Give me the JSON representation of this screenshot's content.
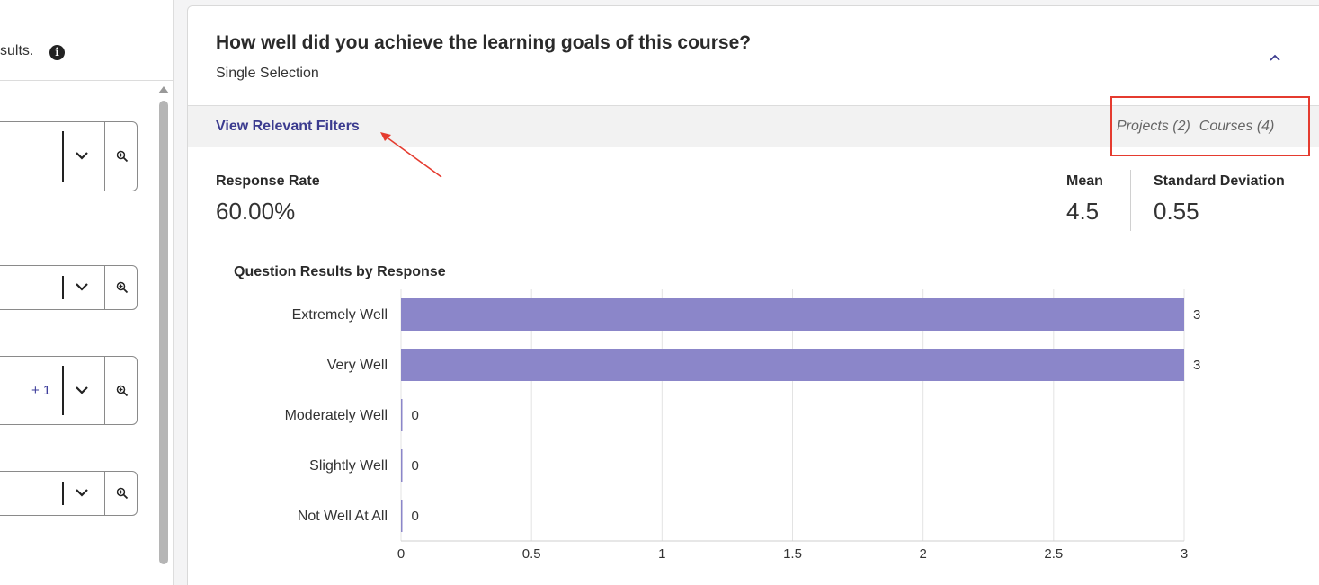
{
  "left_panel": {
    "note_text": "sults.",
    "filters": [
      {
        "count": ""
      },
      {
        "count": ""
      },
      {
        "count": "+ 1"
      },
      {
        "count": ""
      }
    ]
  },
  "question": {
    "title": "How well did you achieve the learning goals of this course?",
    "type": "Single Selection"
  },
  "filter_bar": {
    "link_label": "View Relevant Filters",
    "tags": [
      "Projects (2)",
      "Courses (4)"
    ]
  },
  "stats": {
    "response_rate_label": "Response Rate",
    "response_rate_value": "60.00%",
    "mean_label": "Mean",
    "mean_value": "4.5",
    "sd_label": "Standard Deviation",
    "sd_value": "0.55"
  },
  "colors": {
    "bar": "#8b86c9",
    "accent": "#3b3b8f",
    "highlight": "#e53b2f"
  },
  "chart_data": {
    "type": "bar",
    "orientation": "horizontal",
    "title": "Question Results by Response",
    "categories": [
      "Extremely Well",
      "Very Well",
      "Moderately Well",
      "Slightly Well",
      "Not Well At All"
    ],
    "values": [
      3,
      3,
      0,
      0,
      0
    ],
    "xlim": [
      0,
      3
    ],
    "xticks": [
      "0",
      "0.5",
      "1",
      "1.5",
      "2",
      "2.5",
      "3"
    ],
    "grid": true
  }
}
